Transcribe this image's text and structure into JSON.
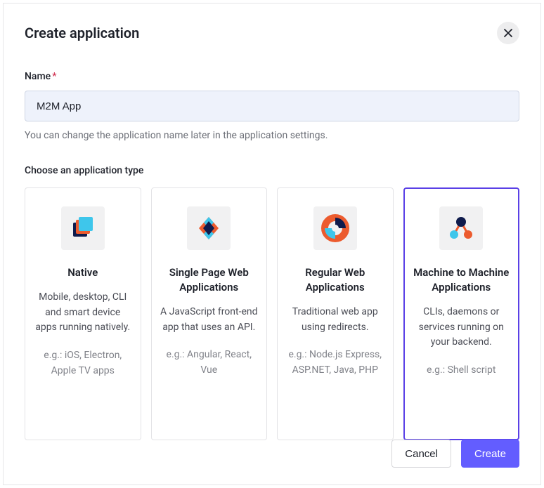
{
  "header": {
    "title": "Create application"
  },
  "nameField": {
    "label": "Name",
    "required": "*",
    "value": "M2M App",
    "help": "You can change the application name later in the application settings."
  },
  "typeSection": {
    "label": "Choose an application type"
  },
  "cards": [
    {
      "title": "Native",
      "desc": "Mobile, desktop, CLI and smart device apps running natively.",
      "examples": "e.g.: iOS, Electron, Apple TV apps"
    },
    {
      "title": "Single Page Web Applications",
      "desc": "A JavaScript front-end app that uses an API.",
      "examples": "e.g.: Angular, React, Vue"
    },
    {
      "title": "Regular Web Applications",
      "desc": "Traditional web app using redirects.",
      "examples": "e.g.: Node.js Express, ASP.NET, Java, PHP"
    },
    {
      "title": "Machine to Machine Applications",
      "desc": "CLIs, daemons or services running on your backend.",
      "examples": "e.g.: Shell script"
    }
  ],
  "selectedCardIndex": 3,
  "footer": {
    "cancel": "Cancel",
    "create": "Create"
  }
}
